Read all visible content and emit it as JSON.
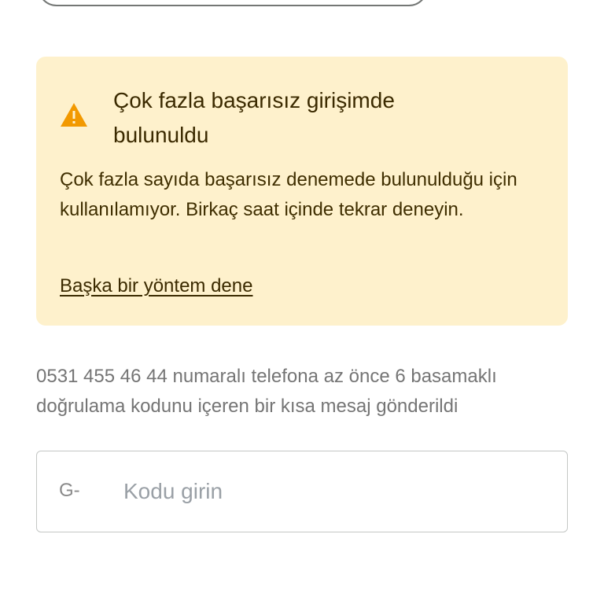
{
  "alert": {
    "title": "Çok fazla başarısız girişimde bulunuldu",
    "body": "Çok fazla sayıda başarısız denemede bulunulduğu için kullanılamıyor. Birkaç saat içinde tekrar deneyin.",
    "link_label": "Başka bir yöntem dene",
    "icon": "warning-icon",
    "background_color": "#fef1cc",
    "icon_color": "#f29900"
  },
  "verification": {
    "message": "0531 455 46 44 numaralı telefona az önce 6 basamaklı doğrulama kodunu içeren bir kısa mesaj gönderildi",
    "code_prefix": "G-",
    "code_value": "",
    "code_placeholder": "Kodu girin"
  }
}
